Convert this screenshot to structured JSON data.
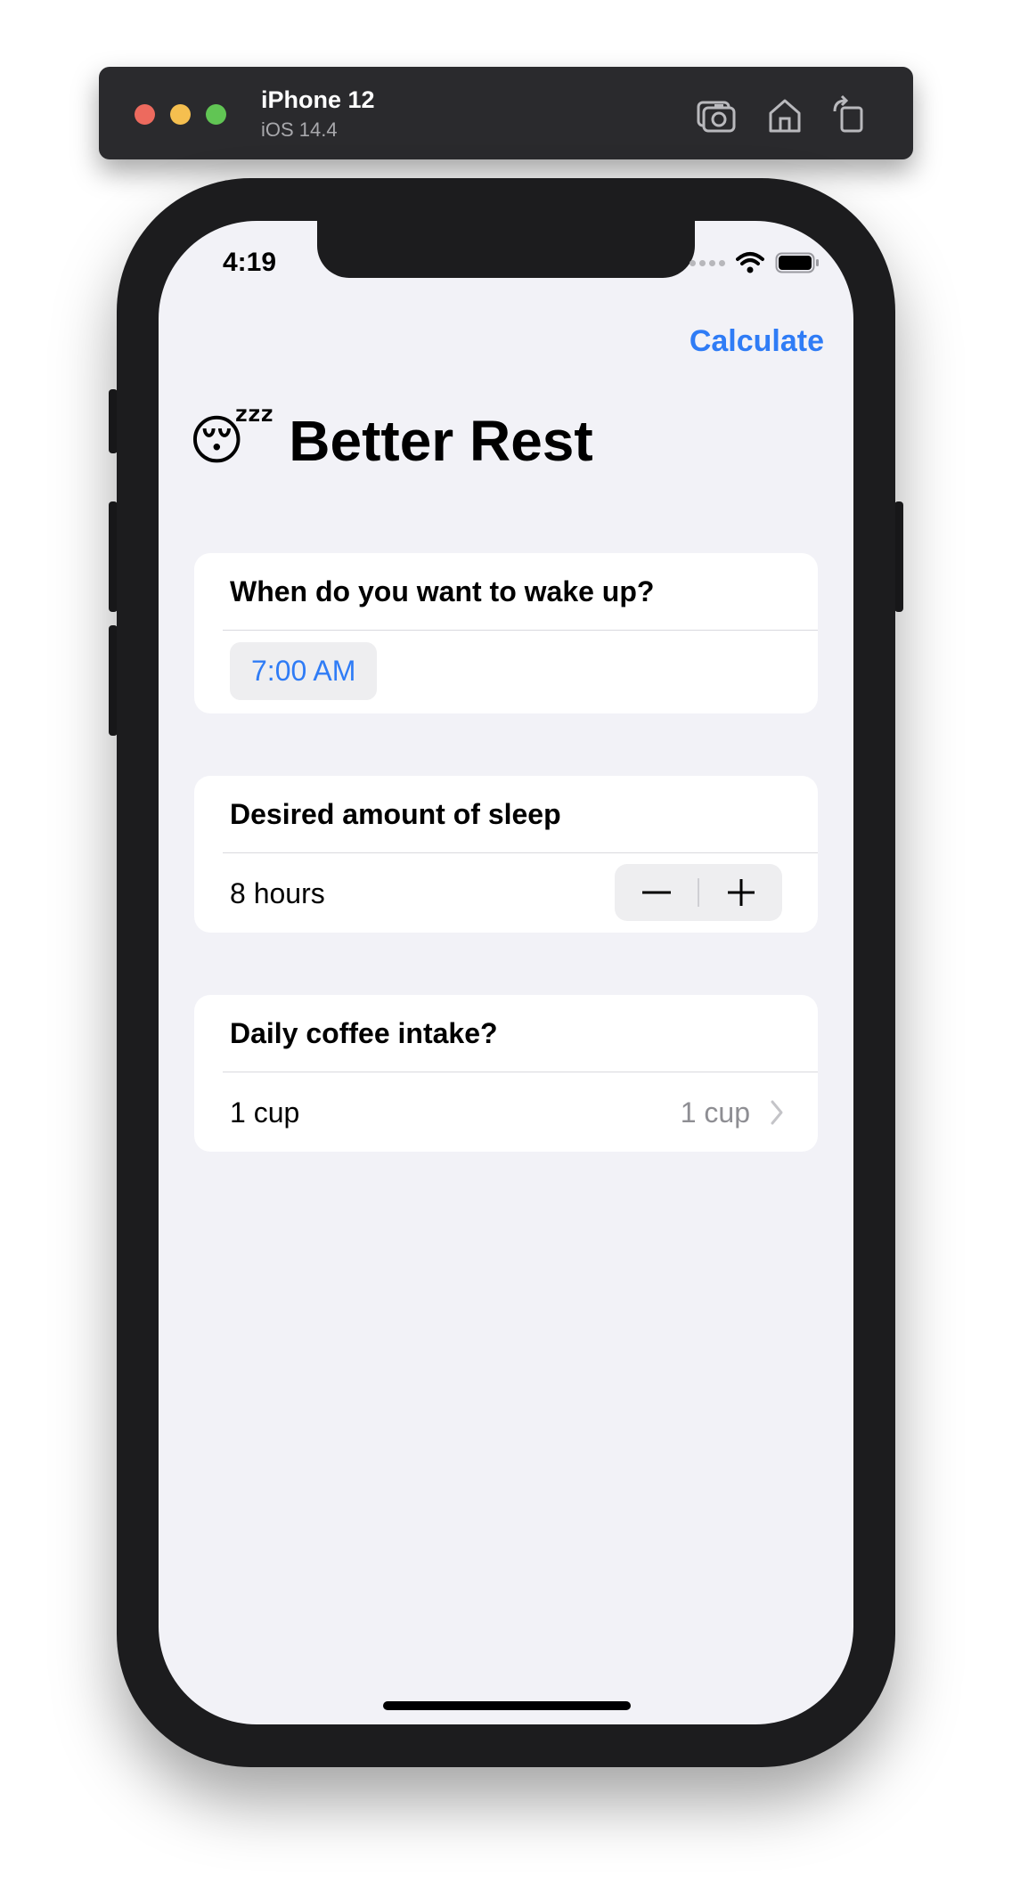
{
  "simulator": {
    "device_name": "iPhone 12",
    "os_version": "iOS 14.4",
    "toolbar_icons": [
      "screenshot-icon",
      "home-icon",
      "rotate-icon"
    ]
  },
  "status_bar": {
    "time": "4:19",
    "icons": [
      "cellular-signal-icon",
      "wifi-icon",
      "battery-icon"
    ]
  },
  "nav": {
    "action_label": "Calculate",
    "title_emoji": "😴",
    "title": "Better Rest"
  },
  "sections": {
    "wake": {
      "header": "When do you want to wake up?",
      "value": "7:00 AM"
    },
    "sleep": {
      "header": "Desired amount of sleep",
      "value": "8 hours",
      "decrement_label": "−",
      "increment_label": "+"
    },
    "coffee": {
      "header": "Daily coffee intake?",
      "label": "1 cup",
      "value": "1 cup"
    }
  },
  "colors": {
    "accent": "#2f7cf6",
    "background": "#f2f2f7",
    "card": "#ffffff",
    "secondary_text": "#8e8e93"
  }
}
